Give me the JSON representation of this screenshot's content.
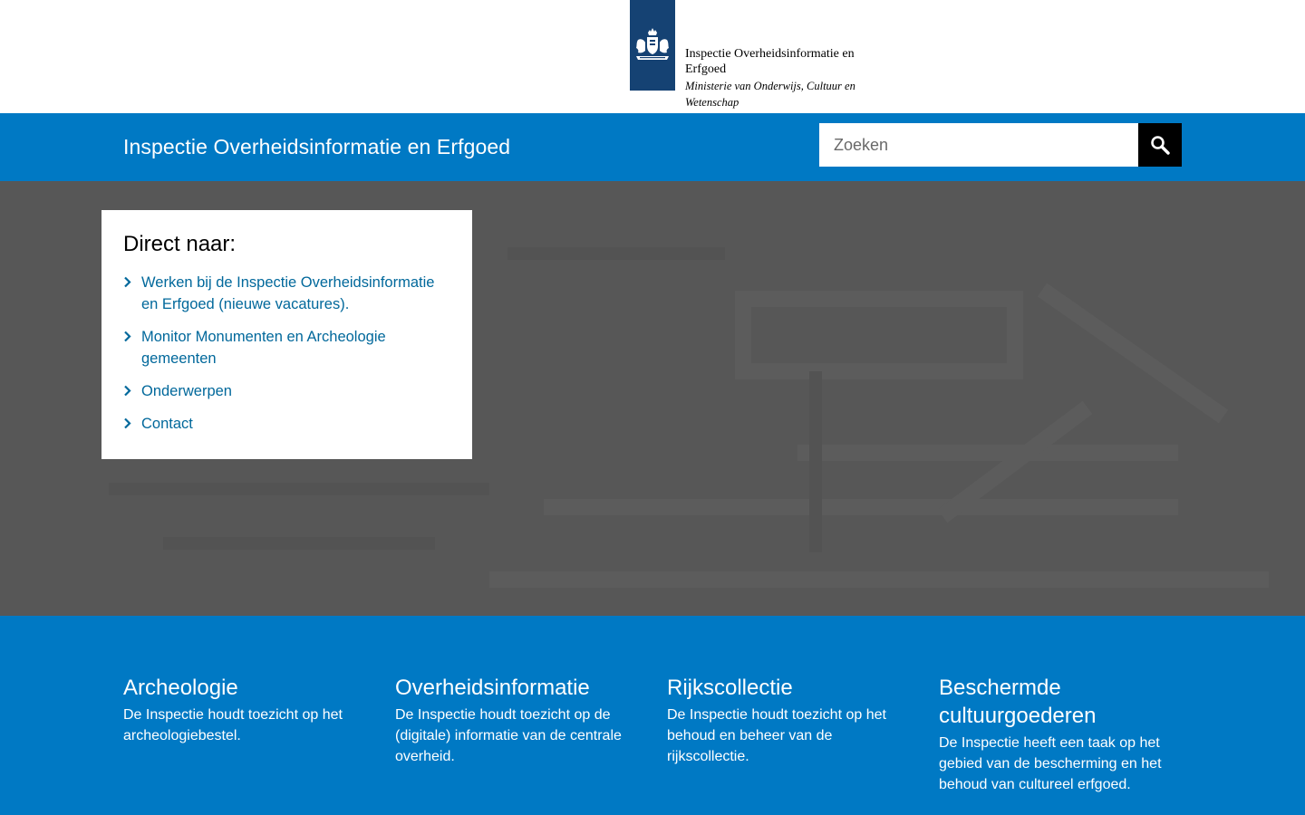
{
  "header": {
    "org_name": "Inspectie Overheidsinformatie en Erfgoed",
    "ministry": "Ministerie van Onderwijs, Cultuur en Wetenschap",
    "logo_icon": "coat-of-arms-icon"
  },
  "navbar": {
    "site_title": "Inspectie Overheidsinformatie en Erfgoed",
    "search_placeholder": "Zoeken",
    "search_value": "",
    "search_icon": "search-icon"
  },
  "direct": {
    "title": "Direct naar:",
    "items": [
      {
        "label": "Werken bij de Inspectie Overheidsinformatie en Erfgoed (nieuwe vacatures)."
      },
      {
        "label": "Monitor Monumenten en Archeologie gemeenten"
      },
      {
        "label": "Onderwerpen"
      },
      {
        "label": "Contact"
      }
    ]
  },
  "tiles": [
    {
      "title": "Archeologie",
      "text": "De Inspectie houdt toezicht op het archeologiebestel."
    },
    {
      "title": "Overheidsinformatie",
      "text": "De Inspectie houdt toezicht op de (digitale) informatie van de centrale overheid."
    },
    {
      "title": "Rijkscollectie",
      "text": "De Inspectie houdt toezicht op het behoud en beheer van de rijkscollectie."
    },
    {
      "title": "Beschermde cultuurgoederen",
      "text": "De Inspectie heeft een taak op het gebied van de bescherming en het behoud van cultureel erfgoed."
    }
  ],
  "colors": {
    "brand_blue": "#0079c4",
    "logo_blue": "#154273",
    "link_blue": "#01689b",
    "hero_gray": "#575757"
  }
}
